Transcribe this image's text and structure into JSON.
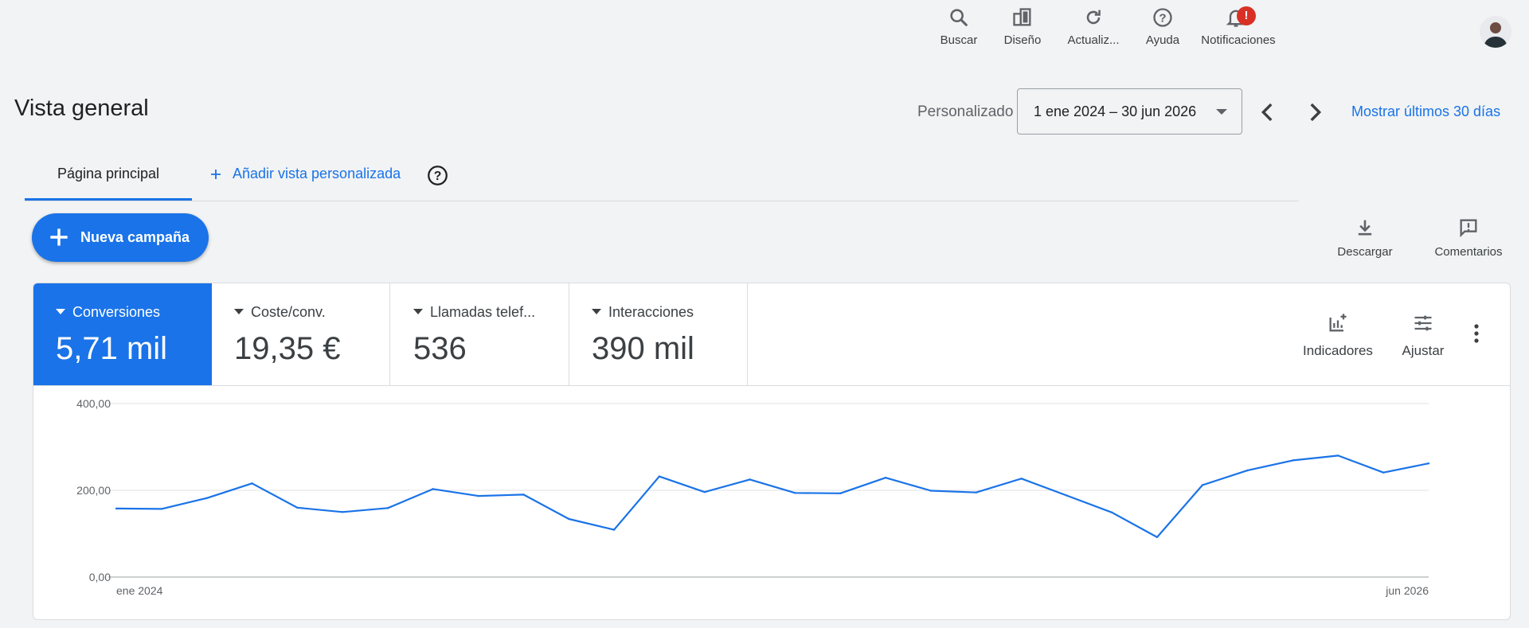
{
  "topbar": {
    "items": [
      {
        "label": "Buscar",
        "icon": "search-icon"
      },
      {
        "label": "Diseño",
        "icon": "layout-icon"
      },
      {
        "label": "Actualiz...",
        "icon": "refresh-icon"
      },
      {
        "label": "Ayuda",
        "icon": "help-icon"
      },
      {
        "label": "Notificaciones",
        "icon": "bell-icon",
        "badge": "!"
      }
    ]
  },
  "header": {
    "title": "Vista general",
    "date_label": "Personalizado",
    "date_range": "1 ene 2024 – 30 jun 2026",
    "show_last": "Mostrar últimos 30 días"
  },
  "tabs": {
    "home": "Página principal",
    "add_view": "Añadir vista personalizada"
  },
  "actions": {
    "new_campaign": "Nueva campaña",
    "download": "Descargar",
    "feedback": "Comentarios"
  },
  "metrics": [
    {
      "label": "Conversiones",
      "value": "5,71 mil",
      "active": true
    },
    {
      "label": "Coste/conv.",
      "value": "19,35 €",
      "active": false
    },
    {
      "label": "Llamadas telef...",
      "value": "536",
      "active": false
    },
    {
      "label": "Interacciones",
      "value": "390 mil",
      "active": false
    }
  ],
  "card_tools": {
    "indicators": "Indicadores",
    "adjust": "Ajustar"
  },
  "colors": {
    "accent": "#1a73e8",
    "badge": "#d93025"
  },
  "chart_data": {
    "type": "line",
    "yticks": [
      "400,00",
      "200,00",
      "0,00"
    ],
    "ylim": [
      0,
      400
    ],
    "x_start_label": "ene 2024",
    "x_end_label": "jun 2026",
    "series": [
      {
        "values": [
          158,
          157,
          182,
          216,
          160,
          150,
          159,
          203,
          187,
          190,
          134,
          109,
          232,
          196,
          225,
          194,
          193,
          229,
          199,
          195,
          227,
          188,
          149,
          92,
          212,
          246,
          269,
          280,
          241,
          262
        ]
      }
    ],
    "grid": true,
    "color": "#1a73e8"
  }
}
